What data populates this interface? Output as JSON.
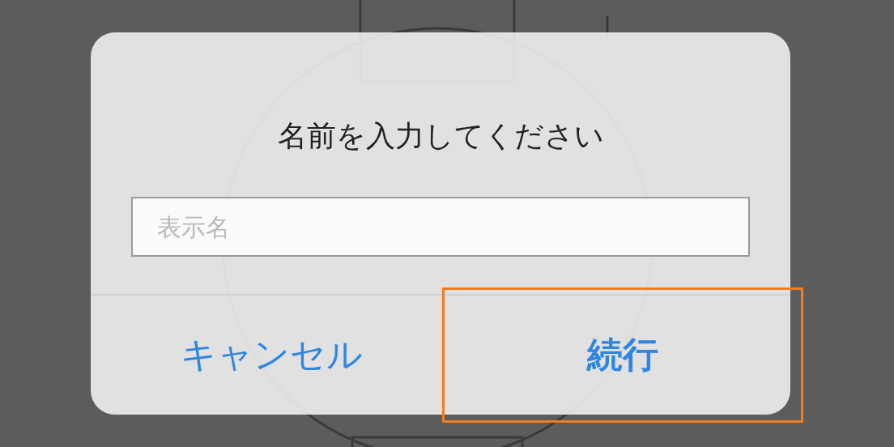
{
  "dialog": {
    "title": "名前を入力してください",
    "field": {
      "placeholder": "表示名"
    },
    "buttons": [
      {
        "label": "キャンセル",
        "kind": "cancel",
        "highlighted": false
      },
      {
        "label": "続行",
        "kind": "primary",
        "highlighted": true
      }
    ]
  }
}
